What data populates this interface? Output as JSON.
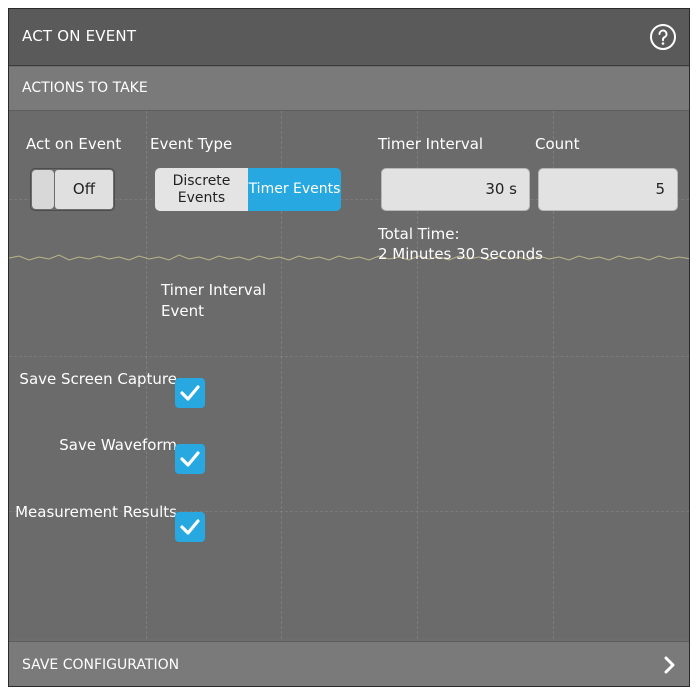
{
  "window": {
    "title": "ACT ON EVENT",
    "help_icon": "help-circle-icon"
  },
  "actions_section": {
    "title": "ACTIONS TO TAKE"
  },
  "act_on_event": {
    "label": "Act on Event",
    "value": "Off"
  },
  "event_type": {
    "label": "Event Type",
    "options": [
      "Discrete Events",
      "Timer Events"
    ],
    "selected": "Timer Events"
  },
  "timer_interval": {
    "label": "Timer Interval",
    "value": "30 s"
  },
  "count": {
    "label": "Count",
    "value": "5"
  },
  "total_time": {
    "label": "Total Time:",
    "value": "2 Minutes 30 Seconds"
  },
  "event_column_header": "Timer Interval Event",
  "actions": [
    {
      "label": "Save Screen Capture",
      "checked": true
    },
    {
      "label": "Save Waveform",
      "checked": true
    },
    {
      "label": "Measurement Results",
      "checked": true
    }
  ],
  "save_configuration": {
    "title": "SAVE CONFIGURATION",
    "icon": "chevron-right-icon"
  },
  "colors": {
    "accent": "#27a8e0",
    "panel": "#6b6b6b",
    "header": "#5a5a5a"
  }
}
